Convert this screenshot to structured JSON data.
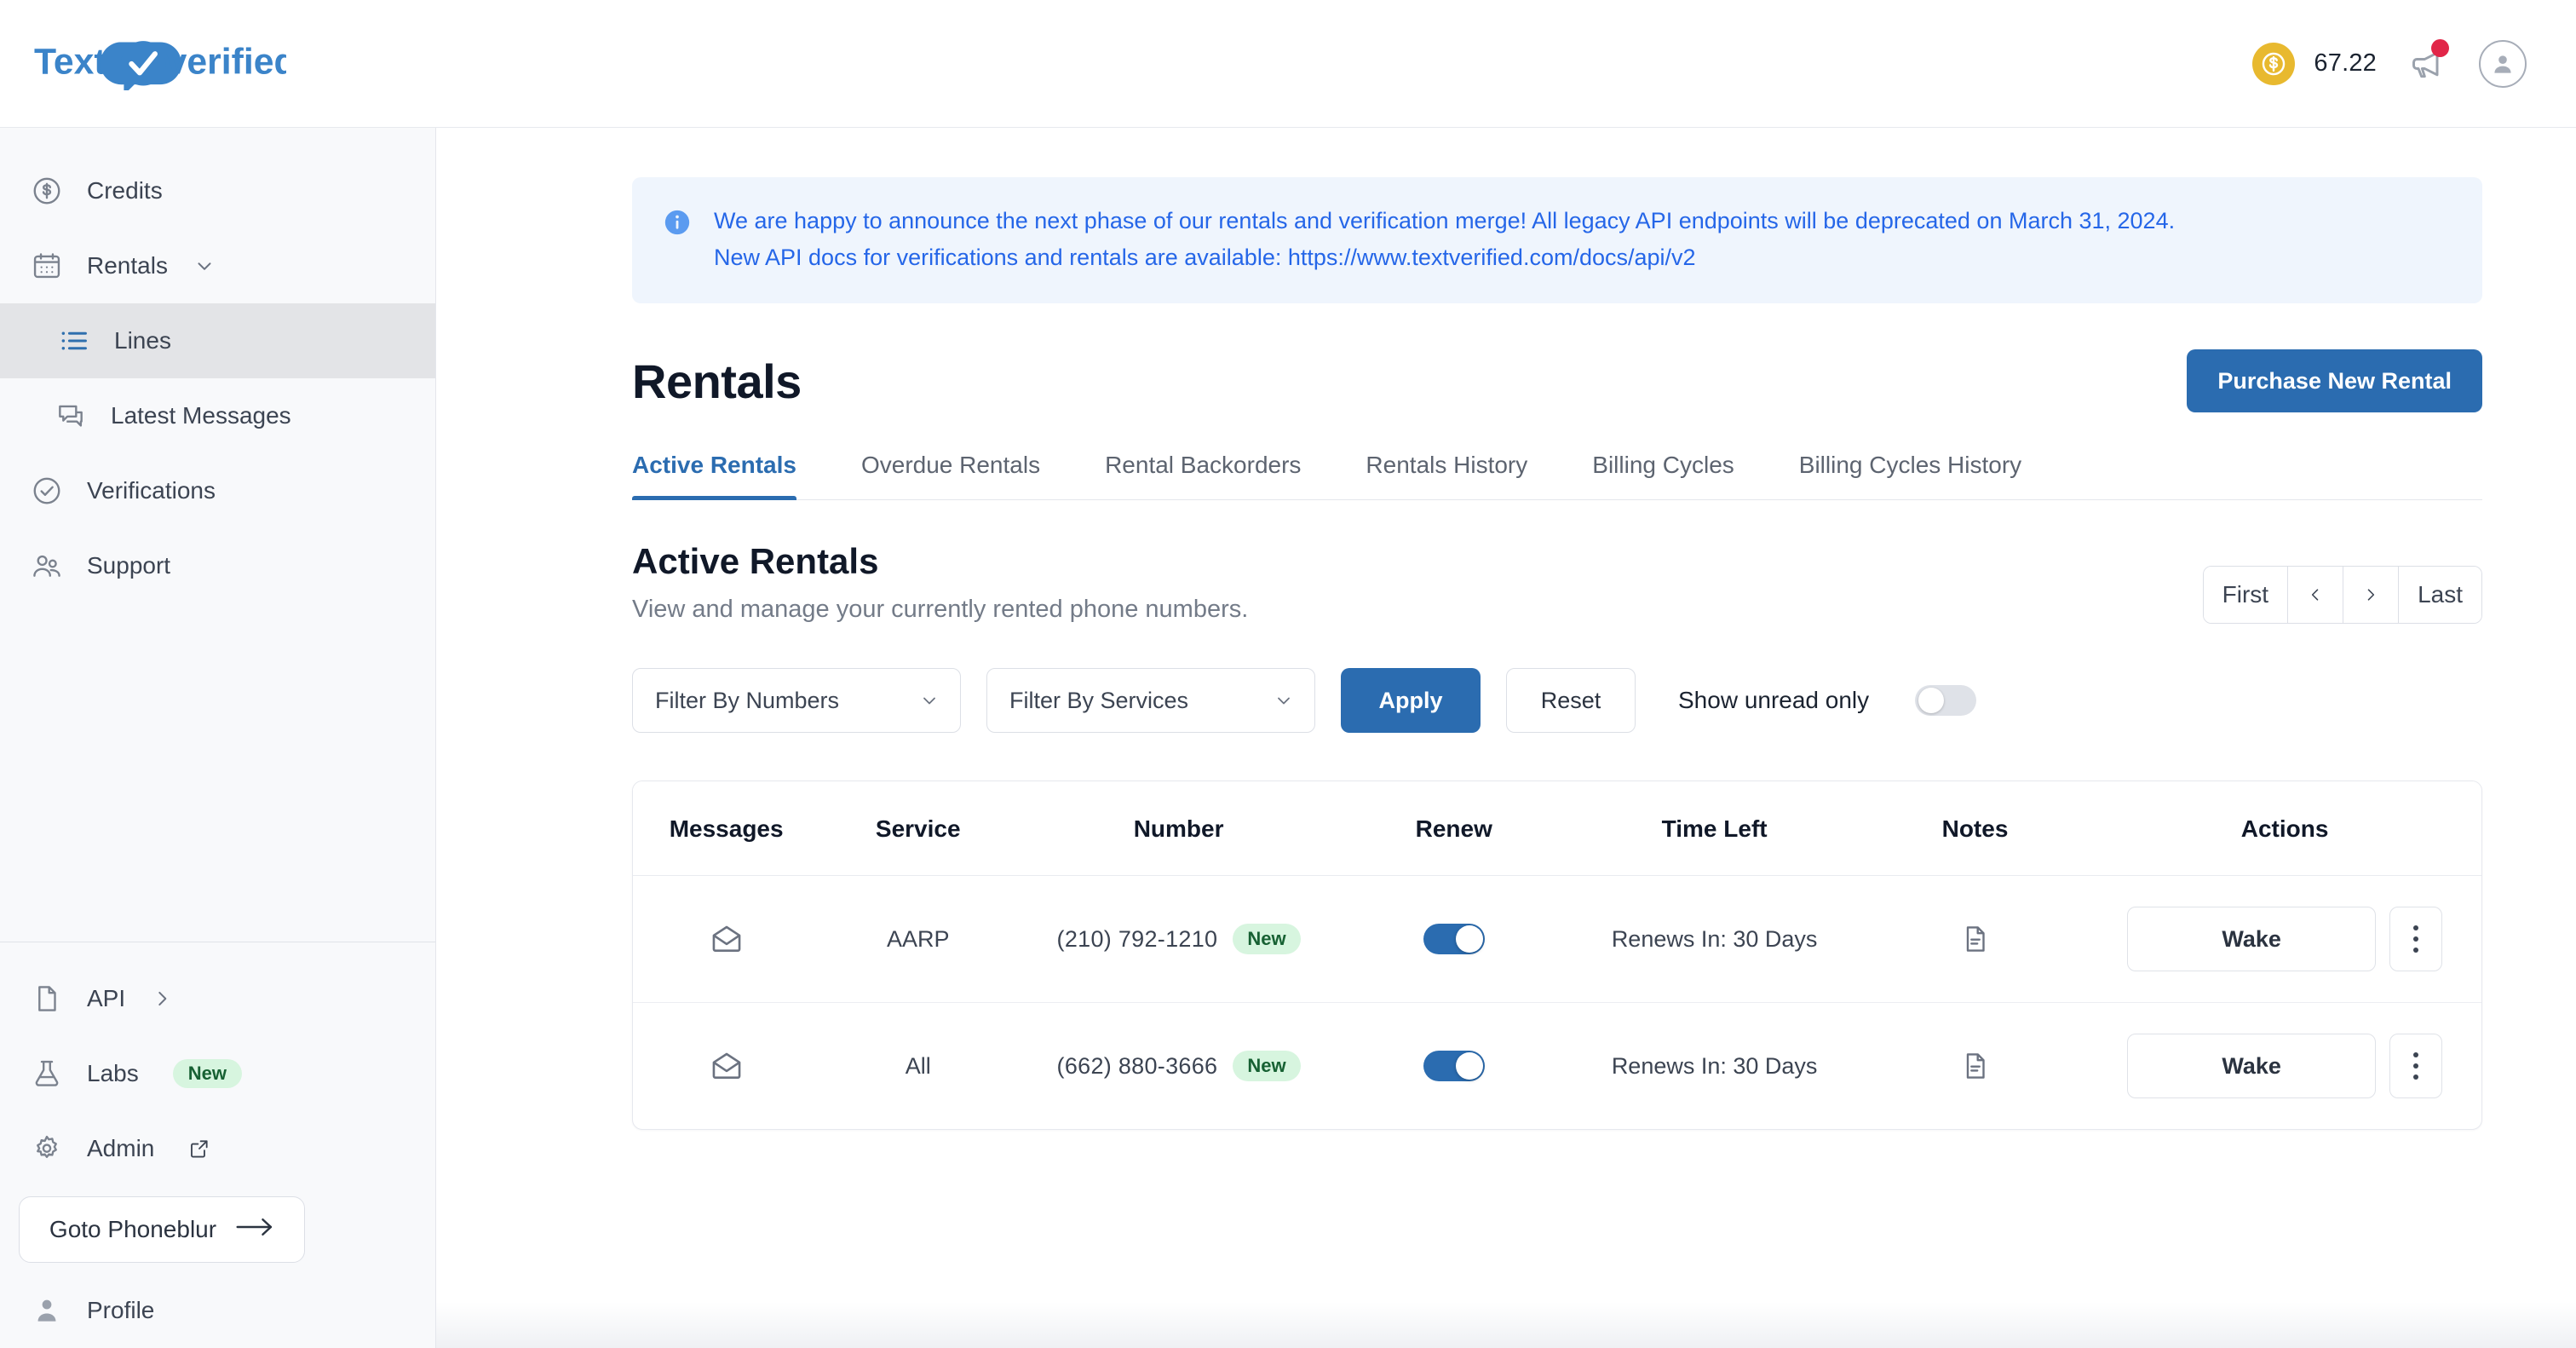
{
  "header": {
    "logo_text_left": "Text",
    "logo_text_right": "verified",
    "balance": "67.22",
    "coin_icon": "dollar-coin-icon",
    "announcement_icon": "megaphone-icon",
    "avatar_icon": "user-avatar-icon",
    "colors": {
      "brand_blue": "#2b6cb0",
      "coin_gold": "#e8b92f",
      "badge_red": "#e12648"
    }
  },
  "sidebar": {
    "top_items": [
      {
        "label": "Credits",
        "icon": "dollar-circle-icon",
        "active": false
      },
      {
        "label": "Rentals",
        "icon": "calendar-icon",
        "active": false,
        "chevron": "chevron-down-icon"
      },
      {
        "label": "Lines",
        "icon": "list-icon",
        "active": true
      },
      {
        "label": "Latest Messages",
        "icon": "chat-bubbles-icon",
        "active": false
      },
      {
        "label": "Verifications",
        "icon": "check-circle-icon",
        "active": false
      },
      {
        "label": "Support",
        "icon": "people-icon",
        "active": false
      }
    ],
    "bottom_items": [
      {
        "label": "API",
        "icon": "document-icon",
        "chevron": "chevron-right-icon"
      },
      {
        "label": "Labs",
        "icon": "flask-icon",
        "badge": "New"
      },
      {
        "label": "Admin",
        "icon": "gear-icon",
        "external": "external-link-icon"
      }
    ],
    "phoneblur_button": {
      "label": "Goto Phoneblur",
      "icon": "arrow-right-icon"
    },
    "profile_item": {
      "label": "Profile",
      "icon": "person-icon"
    }
  },
  "banner": {
    "icon": "info-icon",
    "line1": "We are happy to announce the next phase of our rentals and verification merge! All legacy API endpoints will be deprecated on March 31, 2024.",
    "line2": "New API docs for verifications and rentals are available: https://www.textverified.com/docs/api/v2"
  },
  "page": {
    "title": "Rentals",
    "purchase_button": "Purchase New Rental",
    "tabs": [
      {
        "label": "Active Rentals",
        "active": true
      },
      {
        "label": "Overdue Rentals",
        "active": false
      },
      {
        "label": "Rental Backorders",
        "active": false
      },
      {
        "label": "Rentals History",
        "active": false
      },
      {
        "label": "Billing Cycles",
        "active": false
      },
      {
        "label": "Billing Cycles History",
        "active": false
      }
    ],
    "section_title": "Active Rentals",
    "section_subtitle": "View and manage your currently rented phone numbers."
  },
  "pagination": {
    "first": "First",
    "prev_icon": "chevron-left-icon",
    "next_icon": "chevron-right-icon",
    "last": "Last"
  },
  "filters": {
    "numbers_select": "Filter By Numbers",
    "services_select": "Filter By Services",
    "apply_button": "Apply",
    "reset_button": "Reset",
    "unread_label": "Show unread only",
    "unread_toggle_state": "off"
  },
  "table": {
    "columns": [
      "Messages",
      "Service",
      "Number",
      "Renew",
      "Time Left",
      "Notes",
      "Actions"
    ],
    "rows": [
      {
        "messages_icon": "envelope-icon",
        "service": "AARP",
        "number": "(210) 792-1210",
        "number_tag": "New",
        "renew_toggle": "on",
        "time_left": "Renews In: 30 Days",
        "notes_icon": "note-document-icon",
        "action_button": "Wake",
        "menu_icon": "kebab-menu-icon"
      },
      {
        "messages_icon": "envelope-icon",
        "service": "All",
        "number": "(662) 880-3666",
        "number_tag": "New",
        "renew_toggle": "on",
        "time_left": "Renews In: 30 Days",
        "notes_icon": "note-document-icon",
        "action_button": "Wake",
        "menu_icon": "kebab-menu-icon"
      }
    ]
  }
}
